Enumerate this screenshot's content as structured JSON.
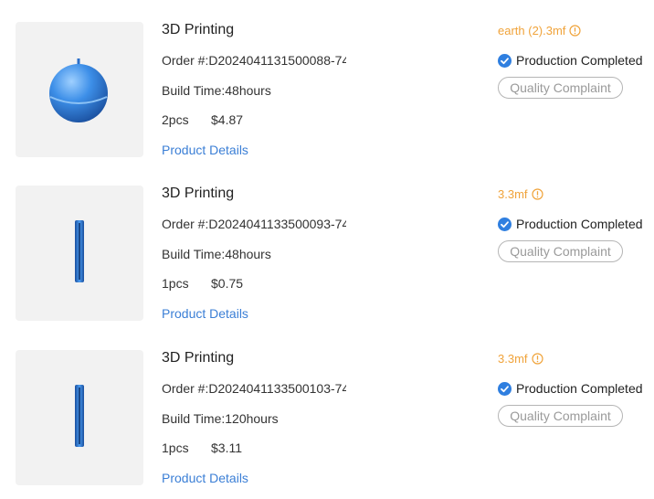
{
  "orders": [
    {
      "title": "3D Printing",
      "order_no": "Order #:D2024041131500088-74",
      "build_time": "Build Time:48hours",
      "quantity": "2pcs",
      "price": "$4.87",
      "details_link": "Product Details",
      "file_name": "earth (2).3mf",
      "status": "Production Completed",
      "complaint_button": "Quality Complaint",
      "thumbnail_icon": "sphere-model-icon"
    },
    {
      "title": "3D Printing",
      "order_no": "Order #:D2024041133500093-74",
      "build_time": "Build Time:48hours",
      "quantity": "1pcs",
      "price": "$0.75",
      "details_link": "Product Details",
      "file_name": "3.3mf",
      "status": "Production Completed",
      "complaint_button": "Quality Complaint",
      "thumbnail_icon": "bar-model-icon"
    },
    {
      "title": "3D Printing",
      "order_no": "Order #:D2024041133500103-74",
      "build_time": "Build Time:120hours",
      "quantity": "1pcs",
      "price": "$3.11",
      "details_link": "Product Details",
      "file_name": "3.3mf",
      "status": "Production Completed",
      "complaint_button": "Quality Complaint",
      "thumbnail_icon": "bar-model-icon"
    }
  ],
  "colors": {
    "accent_orange": "#f0a33a",
    "link_blue": "#3b7fd6",
    "status_blue": "#2f7fe0",
    "model_blue": "#3d8fe8"
  }
}
